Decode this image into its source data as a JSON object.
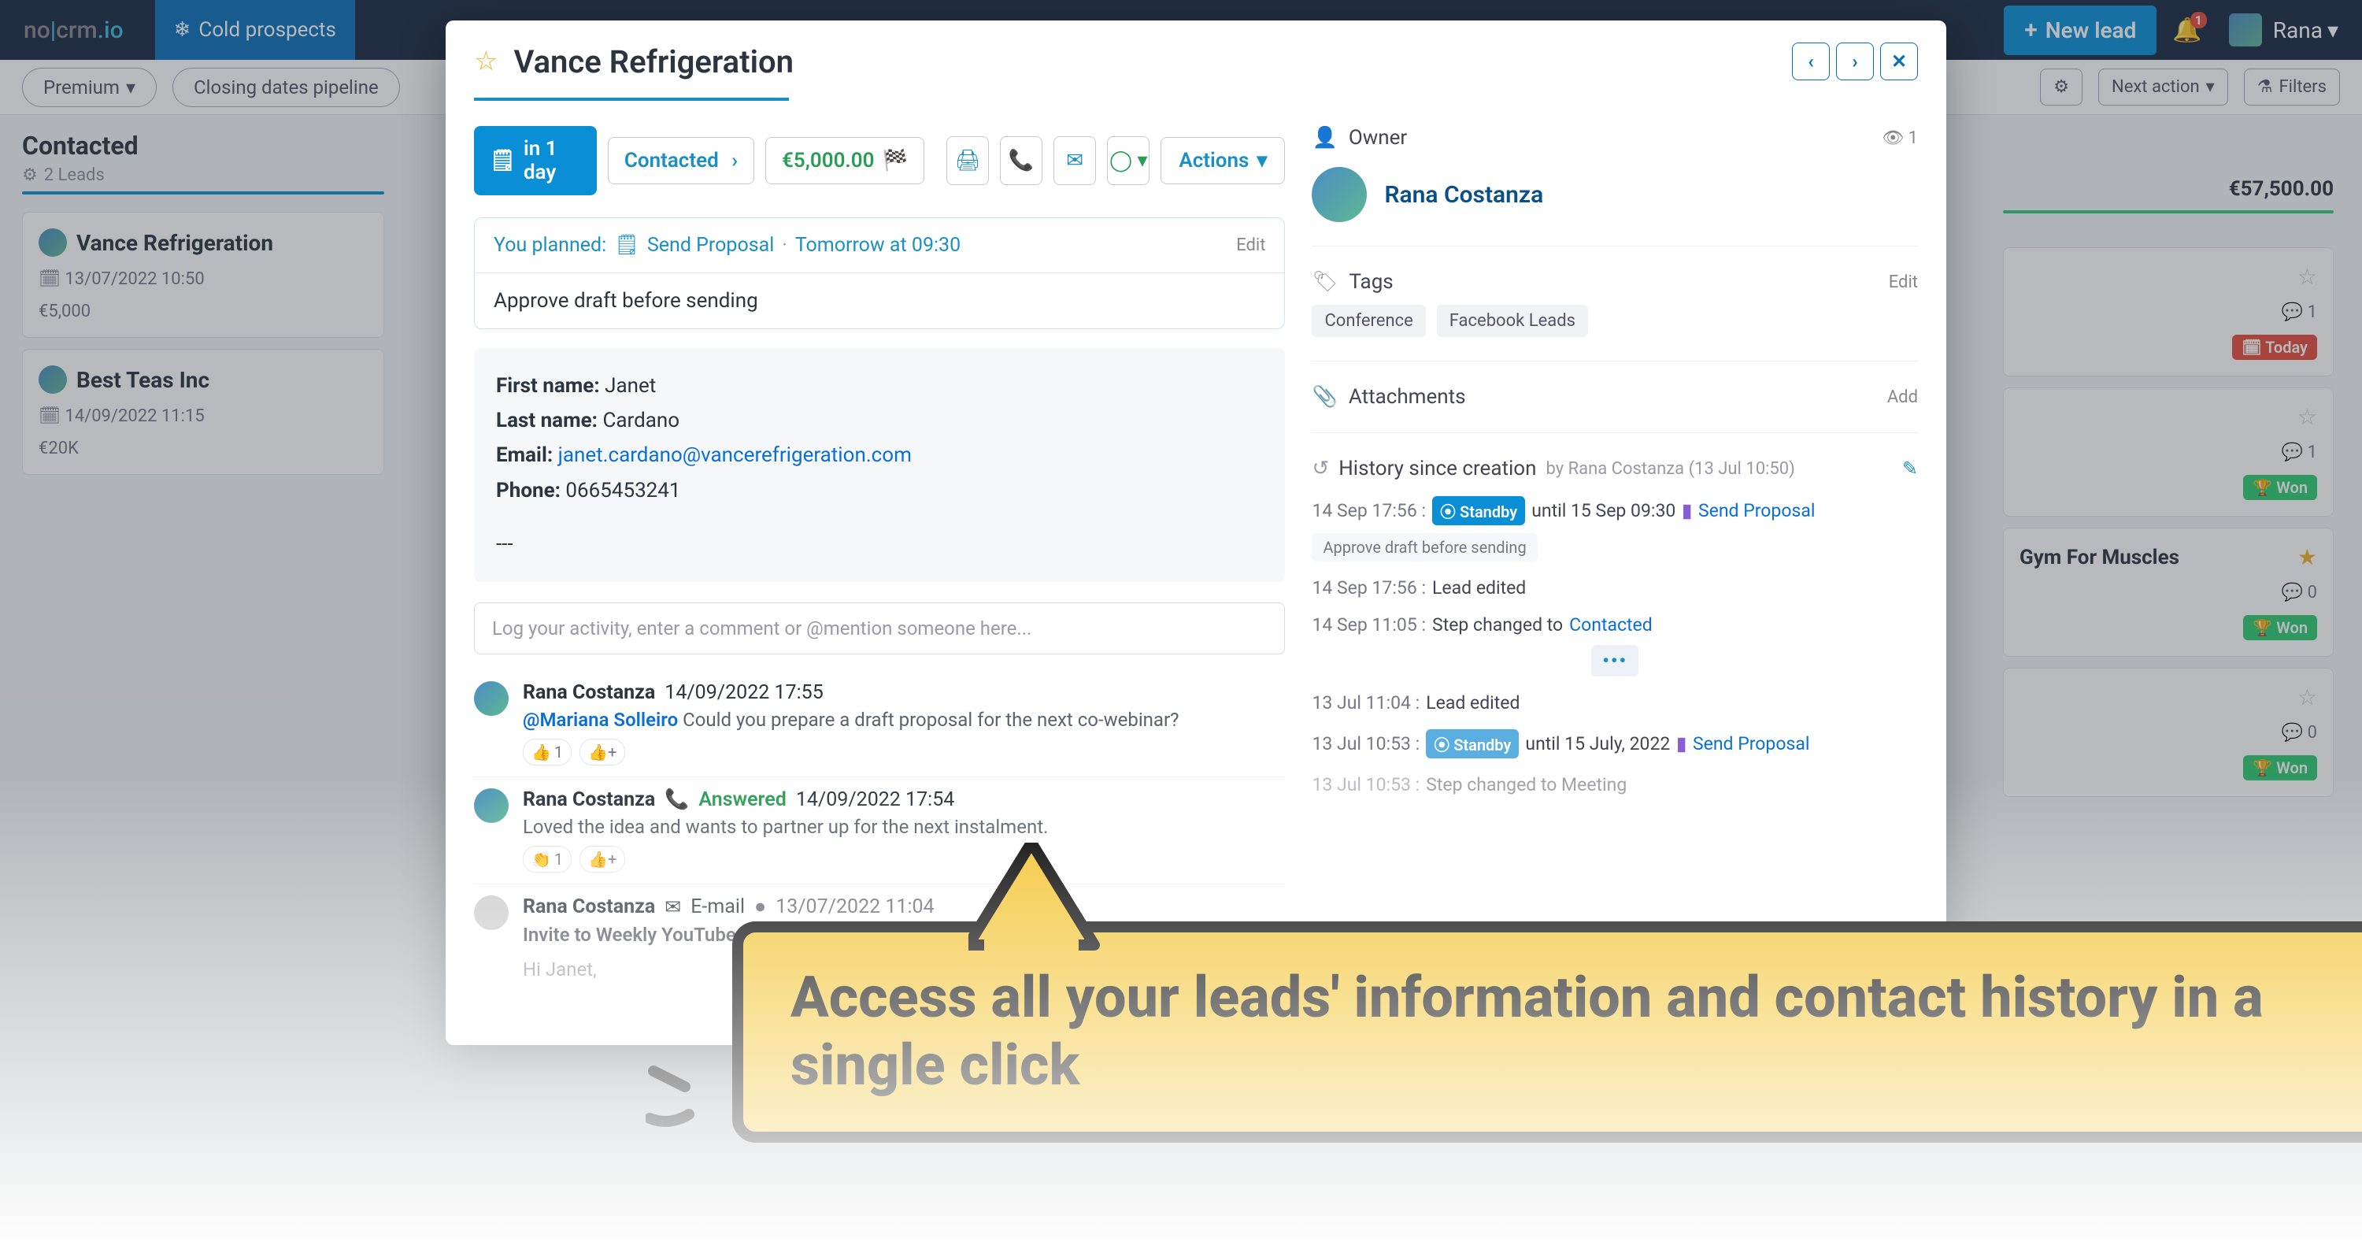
{
  "topbar": {
    "cold": "Cold prospects",
    "newlead": "New lead",
    "bell": "1",
    "user": "Rana"
  },
  "filters": {
    "premium": "Premium",
    "closing": "Closing dates pipeline",
    "next": "Next action",
    "filt": "Filters"
  },
  "col": {
    "title": "Contacted",
    "sub": "2 Leads",
    "total": "€57,500.00"
  },
  "card1": {
    "name": "Vance Refrigeration",
    "date": "13/07/2022 10:50",
    "amt": "€5,000"
  },
  "card2": {
    "name": "Best Teas Inc",
    "date": "14/09/2022 11:15",
    "amt": "€20K"
  },
  "rightcol": [
    {
      "name": "",
      "today": "Today",
      "cmt": "1"
    },
    {
      "name": "",
      "won": "Won",
      "cmt": "1"
    },
    {
      "name": "Gym For Muscles",
      "won": "Won",
      "cmt": "0"
    },
    {
      "name": "",
      "won": "Won",
      "cmt": "0"
    }
  ],
  "modal": {
    "title": "Vance Refrigeration",
    "status": {
      "in": "in 1 day",
      "contacted": "Contacted",
      "amount": "€5,000.00",
      "actions": "Actions"
    },
    "plan": {
      "pre": "You planned:",
      "act": "Send Proposal",
      "when": "Tomorrow at 09:30",
      "edit": "Edit",
      "note": "Approve draft before sending"
    },
    "contact": {
      "fn_l": "First name:",
      "fn": "Janet",
      "ln_l": "Last name:",
      "ln": "Cardano",
      "em_l": "Email:",
      "em": "janet.cardano@vancerefrigeration.com",
      "ph_l": "Phone:",
      "ph": "0665453241",
      "end": "---"
    },
    "loginput": "Log your activity, enter a comment or @mention someone here...",
    "feed": [
      {
        "name": "Rana Costanza",
        "date": "14/09/2022 17:55",
        "mention": "@Mariana Solleiro",
        "text": "Could you prepare a draft proposal for the next co-webinar?",
        "react": "👍",
        "rc": "1"
      },
      {
        "name": "Rana Costanza",
        "ans": "Answered",
        "date": "14/09/2022 17:54",
        "text": "Loved the idea and wants to partner up for the next instalment.",
        "react": "👏",
        "rc": "1"
      },
      {
        "name": "Rana Costanza",
        "em": "E-mail",
        "date": "13/07/2022 11:04",
        "subj": "Invite to Weekly YouTube Sh",
        "greet": "Hi Janet,"
      }
    ],
    "owner": {
      "label": "Owner",
      "count": "1",
      "name": "Rana Costanza"
    },
    "tags": {
      "label": "Tags",
      "edit": "Edit",
      "list": [
        "Conference",
        "Facebook Leads"
      ]
    },
    "attach": {
      "label": "Attachments",
      "add": "Add"
    },
    "history": {
      "label": "History since creation",
      "by": "by Rana Costanza",
      "dt": "(13 Jul 10:50)",
      "rows": [
        {
          "ts": "14 Sep 17:56 :",
          "stdby": "⦿ Standby",
          "until": "until 15 Sep 09:30",
          "prop": "Send Proposal",
          "note": "Approve draft before sending"
        },
        {
          "ts": "14 Sep 17:56 :",
          "txt": "Lead edited"
        },
        {
          "ts": "14 Sep 11:05 :",
          "txt": "Step changed to",
          "lnk": "Contacted"
        },
        {
          "ts": "13 Jul 11:04 :",
          "txt": "Lead edited"
        },
        {
          "ts": "13 Jul 10:53 :",
          "stdby": "⦿ Standby",
          "until": "until 15 July, 2022",
          "prop": "Send Proposal",
          "lt": true
        },
        {
          "ts": "13 Jul 10:53 :",
          "txt": "Step changed to Meeting"
        }
      ]
    }
  },
  "callout": "Access all your leads' information and contact history in a single click"
}
